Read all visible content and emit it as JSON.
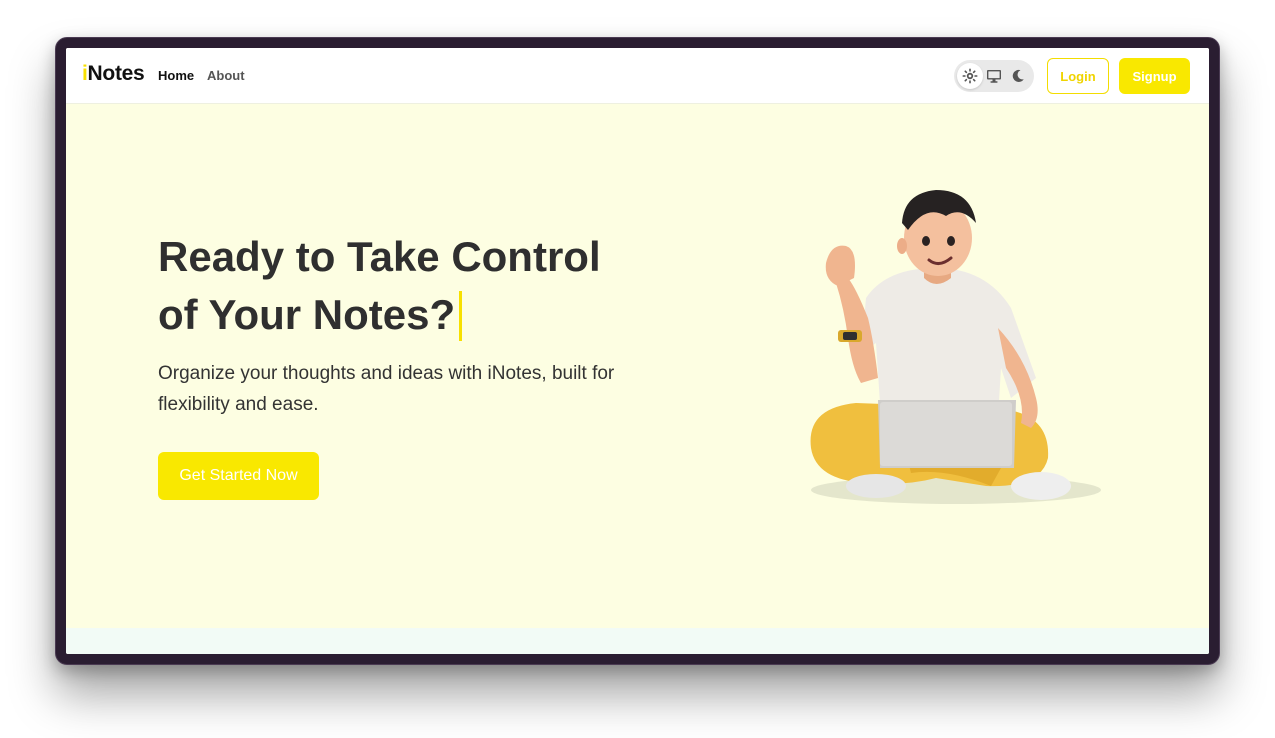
{
  "brand": {
    "prefix": "i",
    "rest": "Notes"
  },
  "nav": {
    "home": "Home",
    "about": "About"
  },
  "theme_toggle": {
    "options": [
      "sun-icon",
      "monitor-icon",
      "moon-icon"
    ],
    "selected": "sun-icon"
  },
  "auth": {
    "login": "Login",
    "signup": "Signup"
  },
  "hero": {
    "title_line1": "Ready to Take Control",
    "title_line2": "of Your Notes?",
    "subtitle": "Organize your thoughts and ideas with iNotes, built for flexibility and ease.",
    "cta": "Get Started Now"
  },
  "colors": {
    "accent": "#f9e800",
    "hero_bg": "#fdfee2",
    "frame": "#2a1d31",
    "text_dark": "#2f2f2f"
  }
}
